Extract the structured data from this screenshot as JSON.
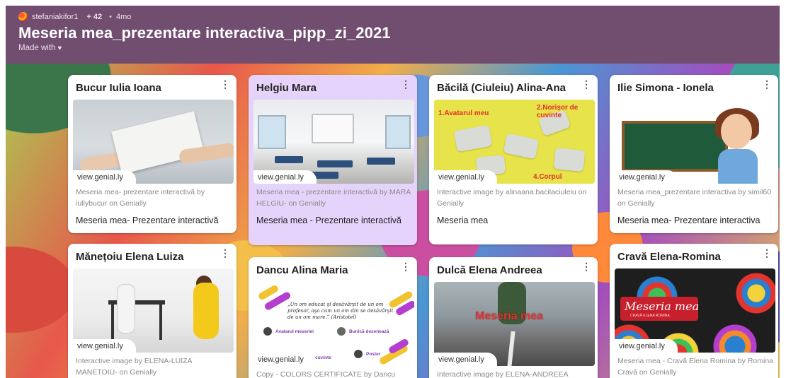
{
  "header": {
    "username": "stefaniakifor1",
    "plus_count": "+ 42",
    "separator": "•",
    "age": "4mo",
    "title": "Meseria mea_prezentare interactiva_pipp_zi_2021",
    "made_with": "Made with"
  },
  "cards": [
    {
      "title": "Bucur Iulia Ioana",
      "source": "view.genial.ly",
      "description": "Meseria mea- prezentare interactivă by iullybucur on Genially",
      "text": "Meseria mea- Prezentare interactivă",
      "thumbnail": "paper-handover-photo"
    },
    {
      "title": "Helgiu Mara",
      "source": "view.genial.ly",
      "description": "Meseria mea - prezentare interactivă by MARA HELGIU- on Genially",
      "text": "Meseria mea - Prezentare interactivă",
      "thumbnail": "classroom-photo",
      "selected": true
    },
    {
      "title": "Băcilă (Ciuleiu) Alina-Ana",
      "source": "view.genial.ly",
      "description": "Interactive image by alinaana.bacilaciuleiu on Genially",
      "text": "Meseria mea",
      "thumbnail": "puzzle-image",
      "thumb_labels": [
        "1.Avatarul meu",
        "2.Norișor de cuvinte",
        "4.Corpul"
      ]
    },
    {
      "title": "Ilie Simona - Ionela",
      "source": "view.genial.ly",
      "description": "Meseria mea_prezentare interactiva by simil60 on Genially",
      "text": "Meseria mea- Prezentare interactiva",
      "thumbnail": "teacher-illustration"
    },
    {
      "title": "Mănețoiu Elena Luiza",
      "source": "view.genial.ly",
      "description": "Interactive image by ELENA-LUIZA MANETOIU- on Genially",
      "thumbnail": "kids-table-photo"
    },
    {
      "title": "Dancu Alina Maria",
      "source": "view.genial.ly",
      "description": "Copy - COLORS CERTIFICATE by Dancu",
      "thumbnail": "certificate-image",
      "thumb_quote": "„Un om educat şi desăvârşit de un om profesor, aşa cum un om din se desăvârşit de un om mare.” (Aristotel)",
      "thumb_items": [
        "Avatarul meseriei",
        "Bunică desenează",
        "Poster"
      ],
      "thumb_word": "'e cuvinte"
    },
    {
      "title": "Dulcă Elena Andreea",
      "source": "view.genial.ly",
      "description": "Interactive image by ELENA-ANDREEA",
      "thumbnail": "road-runner-image",
      "thumb_word": "Meseria mea"
    },
    {
      "title": "Cravă Elena-Romina",
      "source": "view.genial.ly",
      "description": "Meseria mea - Cravă Elena Romina by Romina Cravă on Genially",
      "thumbnail": "rainbow-pattern-image",
      "thumb_word": "Meseria mea",
      "thumb_sub": "CRAVĂ ELENA ROMINA"
    }
  ],
  "icons": {
    "kebab": "⋮",
    "heart": "♥"
  }
}
